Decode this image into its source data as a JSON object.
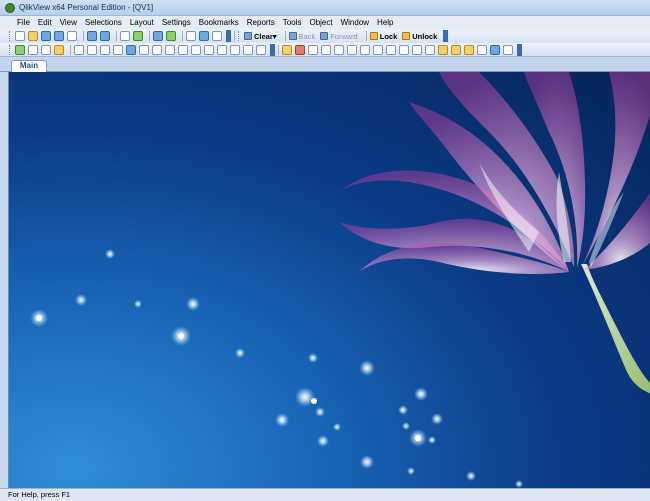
{
  "window": {
    "title": "QlikView x64 Personal Edition - [QV1]"
  },
  "menu": {
    "items": [
      "File",
      "Edit",
      "View",
      "Selections",
      "Layout",
      "Settings",
      "Bookmarks",
      "Reports",
      "Tools",
      "Object",
      "Window",
      "Help"
    ]
  },
  "toolbar": {
    "clear_label": "Clear",
    "back_label": "Back",
    "forward_label": "Forward",
    "lock_label": "Lock",
    "unlock_label": "Unlock"
  },
  "tabs": [
    {
      "label": "Main"
    }
  ],
  "status": {
    "text": "For Help, press F1"
  },
  "colors": {
    "sheet_dark": "#062459",
    "sheet_light": "#2f8fd6",
    "flower_pink": "#e46bbd",
    "flower_white": "#ffffff",
    "stem": "#cfe6a6"
  }
}
